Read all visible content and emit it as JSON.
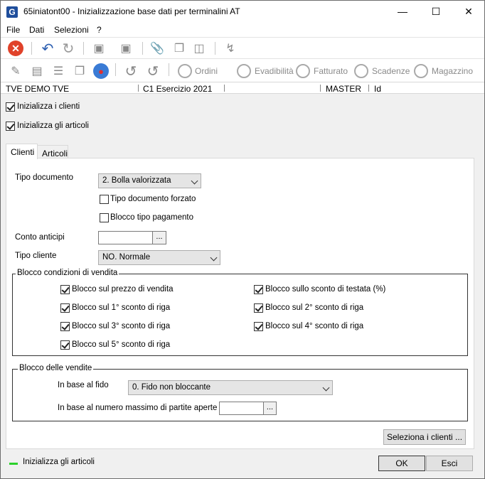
{
  "window": {
    "title": "65iniatont00 - Inizializzazione base dati per terminalini AT",
    "icon_letter": "G"
  },
  "menu": [
    "File",
    "Dati",
    "Selezioni",
    "?"
  ],
  "toolbar2": {
    "ordini": "Ordini",
    "evadibilita": "Evadibilità",
    "fatturato": "Fatturato",
    "scadenze": "Scadenze",
    "magazzino": "Magazzino"
  },
  "infobar": {
    "company": "TVE DEMO TVE",
    "exercise": "C1 Esercizio 2021",
    "user": "MASTER",
    "id": "Id"
  },
  "options": {
    "init_clients": "Inizializza i clienti",
    "init_articles": "Inizializza gli articoli"
  },
  "tabs": [
    "Clienti",
    "Articoli"
  ],
  "form": {
    "tipo_documento_label": "Tipo documento",
    "tipo_documento_value": "2. Bolla valorizzata",
    "tipo_doc_forzato": "Tipo documento forzato",
    "blocco_tipo_pag": "Blocco tipo pagamento",
    "conto_anticipi_label": "Conto anticipi",
    "tipo_cliente_label": "Tipo cliente",
    "tipo_cliente_value": "NO. Normale"
  },
  "blocco_condizioni": {
    "title": "Blocco condizioni di vendita",
    "items": [
      "Blocco sul prezzo di vendita",
      "Blocco sullo sconto di testata (%)",
      "Blocco sul 1° sconto di riga",
      "Blocco sul 2° sconto di riga",
      "Blocco sul 3° sconto di riga",
      "Blocco sul 4° sconto di riga",
      "Blocco sul 5° sconto di riga"
    ]
  },
  "blocco_vendite": {
    "title": "Blocco delle vendite",
    "fido_label": "In base al fido",
    "fido_value": "0. Fido non bloccante",
    "partite_label": "In base al numero massimo di partite aperte"
  },
  "buttons": {
    "seleziona": "Seleziona i clienti ...",
    "ok": "OK",
    "esci": "Esci",
    "dots": "..."
  },
  "status": {
    "text": "Inizializza gli articoli",
    "color": "#2bd12b"
  }
}
